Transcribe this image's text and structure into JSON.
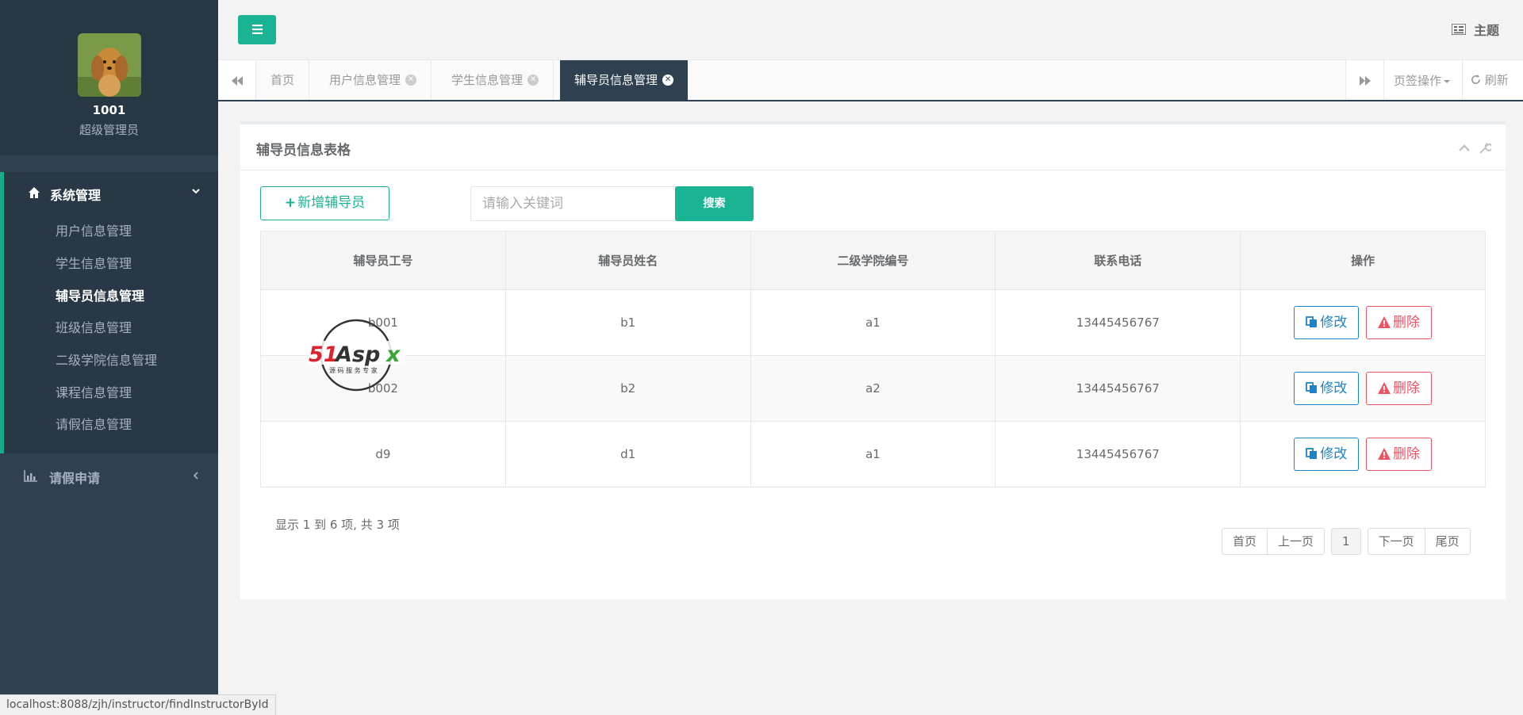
{
  "profile": {
    "name": "1001",
    "role": "超级管理员"
  },
  "sidebar": {
    "group_label": "系统管理",
    "items": [
      {
        "label": "用户信息管理",
        "active": false
      },
      {
        "label": "学生信息管理",
        "active": false
      },
      {
        "label": "辅导员信息管理",
        "active": true
      },
      {
        "label": "班级信息管理",
        "active": false
      },
      {
        "label": "二级学院信息管理",
        "active": false
      },
      {
        "label": "课程信息管理",
        "active": false
      },
      {
        "label": "请假信息管理",
        "active": false
      }
    ],
    "leave_label": "请假申请"
  },
  "header": {
    "theme_label": "主题"
  },
  "tabs": [
    {
      "label": "首页",
      "closable": false,
      "active": false
    },
    {
      "label": "用户信息管理",
      "closable": true,
      "active": false
    },
    {
      "label": "学生信息管理",
      "closable": true,
      "active": false
    },
    {
      "label": "辅导员信息管理",
      "closable": true,
      "active": true
    }
  ],
  "tab_tools": {
    "ops_label": "页签操作",
    "refresh_label": "刷新"
  },
  "panel": {
    "title": "辅导员信息表格",
    "add_label": "新增辅导员",
    "search_placeholder": "请输入关键词",
    "search_label": "搜索"
  },
  "table": {
    "headers": [
      "辅导员工号",
      "辅导员姓名",
      "二级学院编号",
      "联系电话",
      "操作"
    ],
    "rows": [
      {
        "id": "b001",
        "name": "b1",
        "college": "a1",
        "phone": "13445456767"
      },
      {
        "id": "b002",
        "name": "b2",
        "college": "a2",
        "phone": "13445456767"
      },
      {
        "id": "d9",
        "name": "d1",
        "college": "a1",
        "phone": "13445456767"
      }
    ],
    "edit_label": "修改",
    "delete_label": "删除"
  },
  "pagination": {
    "info": "显示 1 到 6 项, 共 3 项",
    "first": "首页",
    "prev": "上一页",
    "current": "1",
    "next": "下一页",
    "last": "尾页"
  },
  "status_url": "localhost:8088/zjh/instructor/findInstructorById",
  "colors": {
    "accent": "#1ab394",
    "sidebar": "#2f4050",
    "edit": "#1c84c6",
    "delete": "#ed5565"
  },
  "icons": {
    "menu": "bars-icon",
    "theme": "theme-icon",
    "home": "home-icon",
    "chevron": "chevron-down-icon",
    "chart": "bar-chart-icon",
    "tab_prev": "backward-icon",
    "tab_next": "forward-icon",
    "close": "close-circle-icon",
    "refresh": "refresh-icon",
    "edit": "copy-icon",
    "delete": "warning-icon",
    "collapse": "chevron-up-icon",
    "settings": "wrench-icon"
  }
}
